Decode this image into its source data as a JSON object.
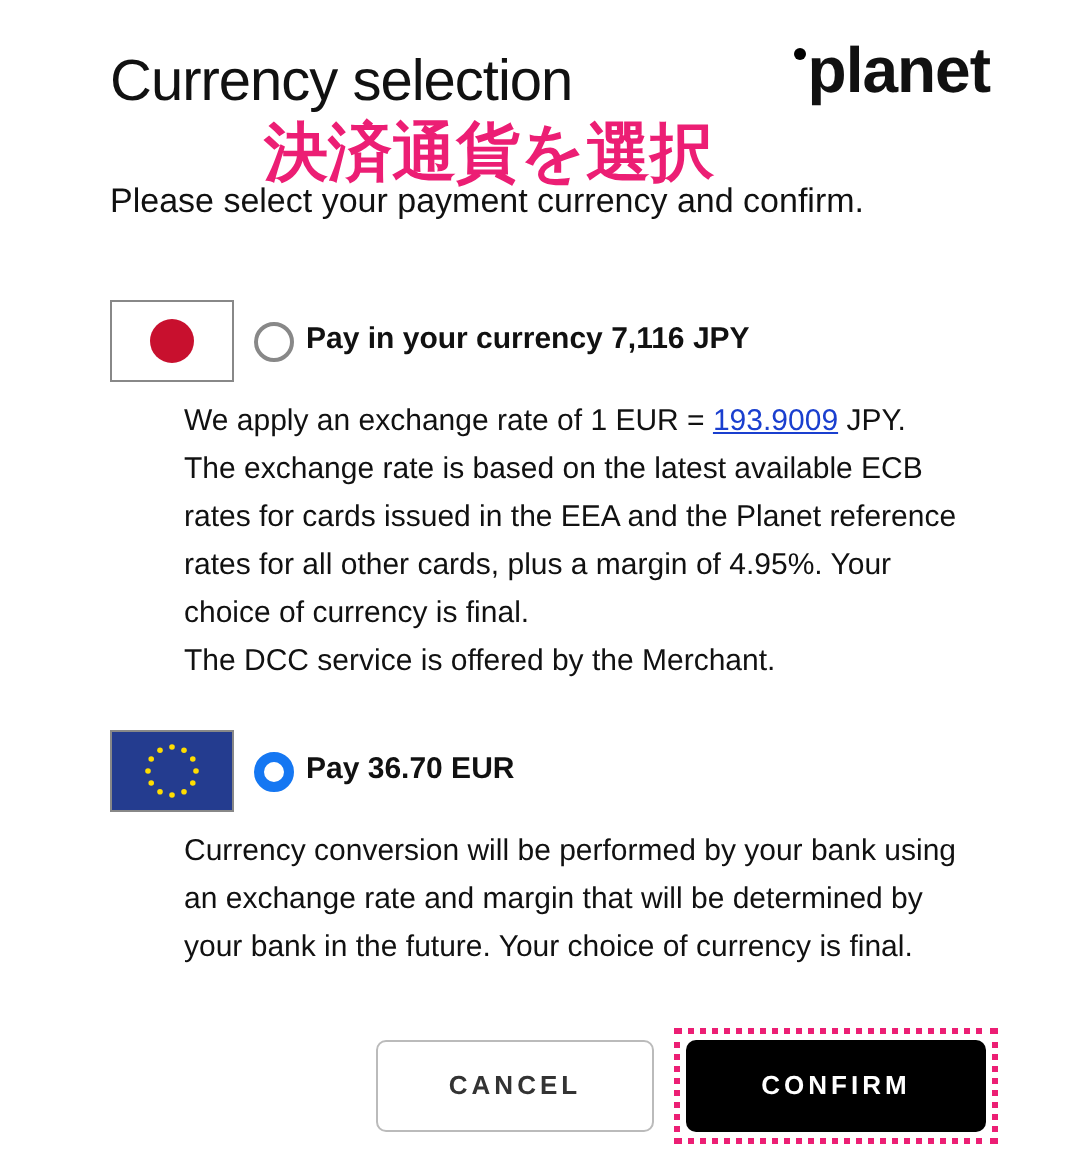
{
  "header": {
    "title": "Currency selection",
    "logo": "planet",
    "annotation": "決済通貨を選択",
    "subtitle": "Please select your payment currency and confirm."
  },
  "options": [
    {
      "kind": "japan",
      "selected": false,
      "label": "Pay in your currency 7,116 JPY",
      "paragraphs": [
        {
          "before": "We apply an exchange rate of 1 EUR = ",
          "link": "193.9009",
          "after": " JPY."
        },
        {
          "before": "The exchange rate is based on the latest available ECB rates for cards issued in the EEA and the Planet reference rates for all other cards, plus a margin of 4.95%. Your choice of currency is final."
        },
        {
          "before": "The DCC service is offered by the Merchant."
        }
      ]
    },
    {
      "kind": "eu",
      "selected": true,
      "label": "Pay 36.70 EUR",
      "paragraphs": [
        {
          "before": "Currency conversion will be performed by your bank using an exchange rate and margin that will be determined by your bank in the future. Your choice of currency is final."
        }
      ]
    }
  ],
  "buttons": [
    {
      "label": "CANCEL",
      "kind": "secondary",
      "highlighted": false
    },
    {
      "label": "CONFIRM",
      "kind": "primary",
      "highlighted": true
    }
  ]
}
